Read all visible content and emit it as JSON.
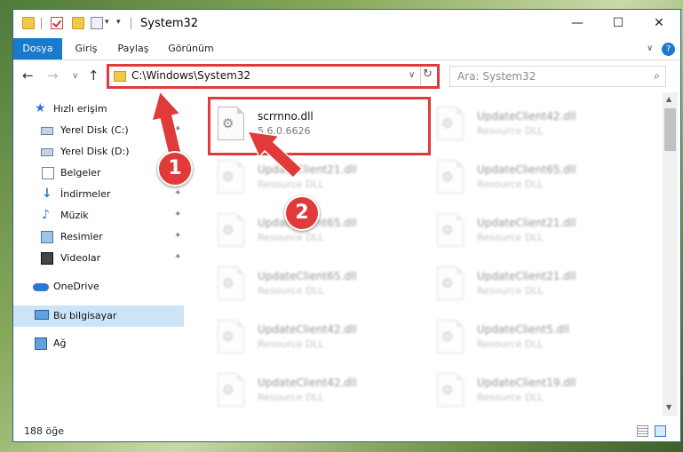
{
  "window": {
    "title": "System32",
    "minimize_glyph": "—",
    "maximize_glyph": "☐",
    "close_glyph": "✕"
  },
  "ribbon": {
    "tabs": [
      "Dosya",
      "Giriş",
      "Paylaş",
      "Görünüm"
    ],
    "active_tab": "Dosya",
    "help_glyph": "?",
    "collapse_glyph": "∨"
  },
  "navigation": {
    "back_glyph": "←",
    "forward_glyph": "→",
    "recent_glyph": "∨",
    "up_glyph": "↑",
    "address": "C:\\Windows\\System32",
    "address_caret": "∨",
    "refresh_glyph": "↻",
    "search_placeholder": "Ara: System32",
    "search_glyph": "⌕"
  },
  "nav_pane": [
    {
      "label": "Hızlı erişim",
      "icon": "quick-access-star-icon",
      "pinned": false,
      "selected": false
    },
    {
      "label": "Yerel Disk (C:)",
      "icon": "drive-icon",
      "pinned": true,
      "selected": false
    },
    {
      "label": "Yerel Disk (D:)",
      "icon": "drive-icon",
      "pinned": true,
      "selected": false
    },
    {
      "label": "Belgeler",
      "icon": "documents-icon",
      "pinned": true,
      "selected": false
    },
    {
      "label": "İndirmeler",
      "icon": "downloads-icon",
      "pinned": true,
      "selected": false
    },
    {
      "label": "Müzik",
      "icon": "music-icon",
      "pinned": true,
      "selected": false
    },
    {
      "label": "Resimler",
      "icon": "pictures-icon",
      "pinned": true,
      "selected": false
    },
    {
      "label": "Videolar",
      "icon": "videos-icon",
      "pinned": true,
      "selected": false
    },
    {
      "label": "OneDrive",
      "icon": "onedrive-icon",
      "pinned": false,
      "selected": false
    },
    {
      "label": "Bu bilgisayar",
      "icon": "this-pc-icon",
      "pinned": false,
      "selected": true
    },
    {
      "label": "Ağ",
      "icon": "network-icon",
      "pinned": false,
      "selected": false
    }
  ],
  "pin_glyph": "📌",
  "files": [
    {
      "name": "scrrnno.dll",
      "desc": "5.6.0.6626",
      "highlighted": true
    },
    {
      "name": "UpdateClient42.dll",
      "desc": "Resource DLL",
      "highlighted": false
    },
    {
      "name": "UpdateClient21.dll",
      "desc": "Resource DLL",
      "highlighted": false
    },
    {
      "name": "UpdateClient65.dll",
      "desc": "Resource DLL",
      "highlighted": false
    },
    {
      "name": "UpdateClient65.dll",
      "desc": "Resource DLL",
      "highlighted": false
    },
    {
      "name": "UpdateClient21.dll",
      "desc": "Resource DLL",
      "highlighted": false
    },
    {
      "name": "UpdateClient65.dll",
      "desc": "Resource DLL",
      "highlighted": false
    },
    {
      "name": "UpdateClient21.dll",
      "desc": "Resource DLL",
      "highlighted": false
    },
    {
      "name": "UpdateClient42.dll",
      "desc": "Resource DLL",
      "highlighted": false
    },
    {
      "name": "UpdateClient5.dll",
      "desc": "Resource DLL",
      "highlighted": false
    },
    {
      "name": "UpdateClient42.dll",
      "desc": "Resource DLL",
      "highlighted": false
    },
    {
      "name": "UpdateClient19.dll",
      "desc": "Resource DLL",
      "highlighted": false
    }
  ],
  "scrollbar": {
    "up_glyph": "▲",
    "down_glyph": "▼"
  },
  "status": {
    "item_count": "188 öğe"
  },
  "annotations": [
    {
      "label": "1",
      "target": "address-bar"
    },
    {
      "label": "2",
      "target": "file-scrrnno"
    }
  ],
  "colors": {
    "accent": "#1979ca",
    "highlight": "#e03a3a",
    "selected": "#cce4f7"
  }
}
